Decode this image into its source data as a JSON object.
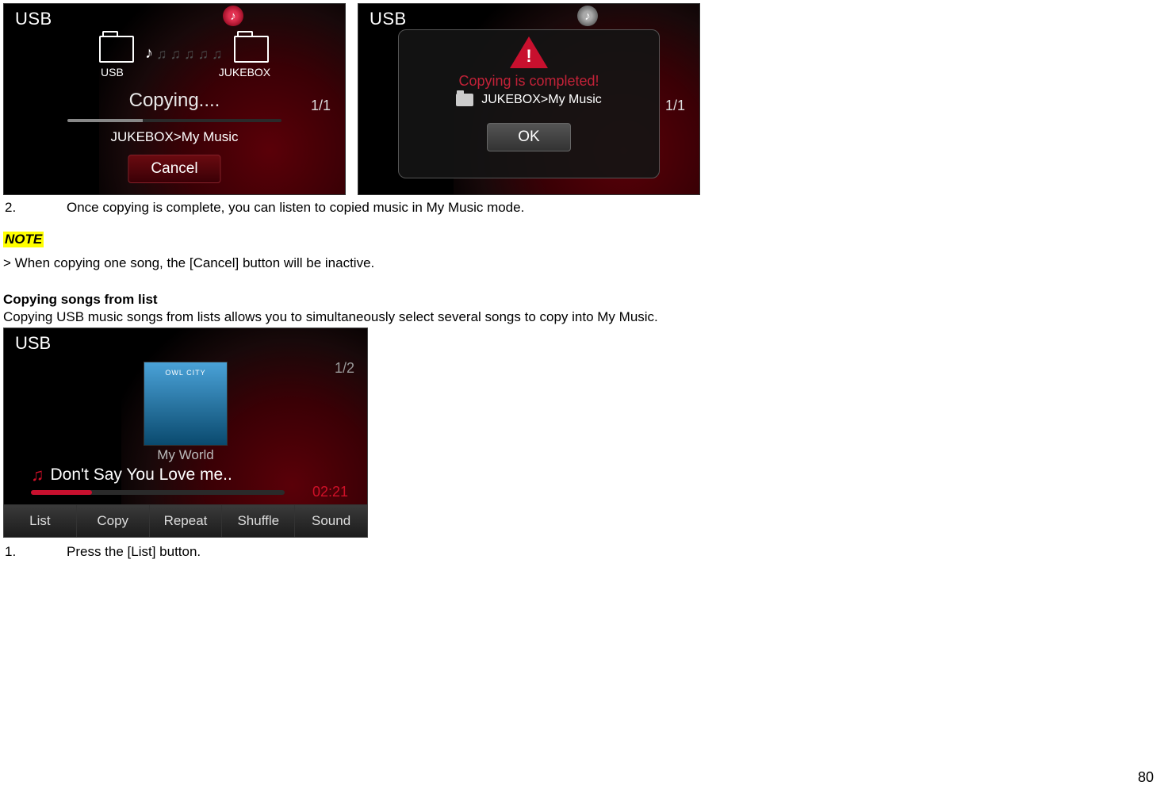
{
  "screens": {
    "copying": {
      "header": "USB",
      "src_label": "USB",
      "dst_label": "JUKEBOX",
      "status": "Copying....",
      "count": "1/1",
      "path": "JUKEBOX>My Music",
      "cancel": "Cancel"
    },
    "done": {
      "header": "USB",
      "message": "Copying is completed!",
      "path": "JUKEBOX>My Music",
      "count": "1/1",
      "ok": "OK"
    },
    "player": {
      "header": "USB",
      "count": "1/2",
      "art_text": "OWL CITY",
      "album": "My World",
      "track": "Don't Say You Love me..",
      "time": "02:21",
      "buttons": [
        "List",
        "Copy",
        "Repeat",
        "Shuffle",
        "Sound"
      ]
    }
  },
  "doc": {
    "step2_num": "2.",
    "step2_text": "Once copying is complete, you can listen to copied music in My Music mode.",
    "note_label": "NOTE",
    "note_text": "> When copying one song, the [Cancel] button will be inactive.",
    "section_title": "Copying songs from list",
    "section_intro": "Copying USB music songs from lists allows you to simultaneously select several songs to copy into My Music.",
    "step1_num": "1.",
    "step1_text": "Press the [List] button.",
    "page_number": "80"
  }
}
